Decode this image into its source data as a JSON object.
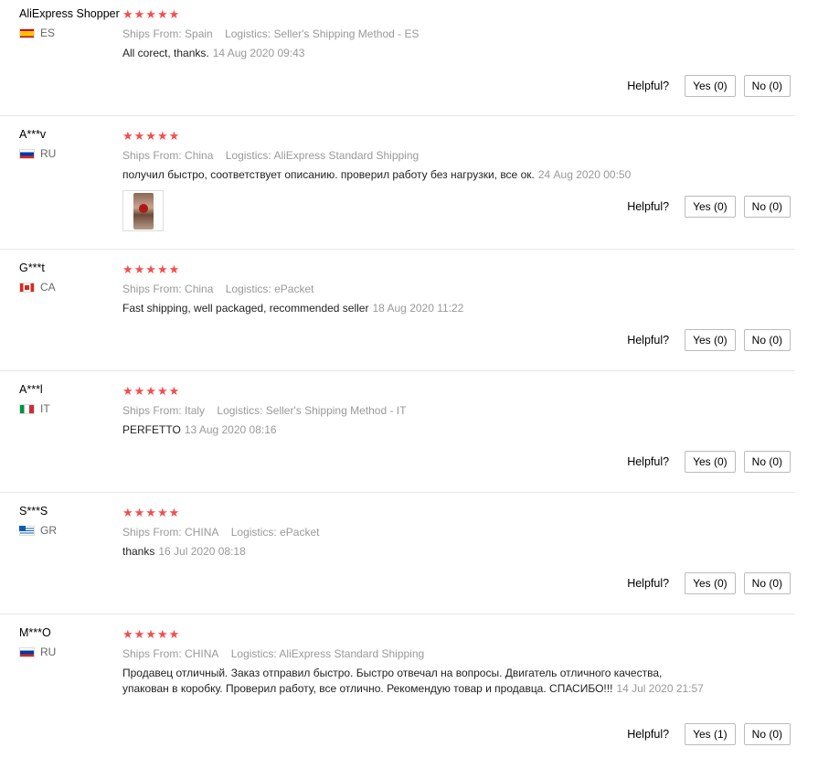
{
  "helpful_label": "Helpful?",
  "star_glyph": "★★★★★",
  "reviews": [
    {
      "user": "AliExpress Shopper",
      "country_code": "ES",
      "flag": "es",
      "ships_from_label": "Ships From:",
      "ships_from": "Spain",
      "logistics_label": "Logistics:",
      "logistics": "Seller's Shipping Method - ES",
      "text": "All corect, thanks.",
      "date": "14 Aug 2020 09:43",
      "yes": "Yes (0)",
      "no": "No (0)"
    },
    {
      "user": "A***v",
      "country_code": "RU",
      "flag": "ru",
      "ships_from_label": "Ships From:",
      "ships_from": "China",
      "logistics_label": "Logistics:",
      "logistics": "AliExpress Standard Shipping",
      "text": "получил быстро, соответствует описанию. проверил работу без нагрузки, все ок.",
      "date": "24 Aug 2020 00:50",
      "yes": "Yes (0)",
      "no": "No (0)"
    },
    {
      "user": "G***t",
      "country_code": "CA",
      "flag": "ca",
      "ships_from_label": "Ships From:",
      "ships_from": "China",
      "logistics_label": "Logistics:",
      "logistics": "ePacket",
      "text": "Fast shipping, well packaged, recommended seller",
      "date": "18 Aug 2020 11:22",
      "yes": "Yes (0)",
      "no": "No (0)"
    },
    {
      "user": "A***l",
      "country_code": "IT",
      "flag": "it",
      "ships_from_label": "Ships From:",
      "ships_from": "Italy",
      "logistics_label": "Logistics:",
      "logistics": "Seller's Shipping Method - IT",
      "text": "PERFETTO",
      "date": "13 Aug 2020 08:16",
      "yes": "Yes (0)",
      "no": "No (0)"
    },
    {
      "user": "S***S",
      "country_code": "GR",
      "flag": "gr",
      "ships_from_label": "Ships From:",
      "ships_from": "CHINA",
      "logistics_label": "Logistics:",
      "logistics": "ePacket",
      "text": "thanks",
      "date": "16 Jul 2020 08:18",
      "yes": "Yes (0)",
      "no": "No (0)"
    },
    {
      "user": "M***O",
      "country_code": "RU",
      "flag": "ru",
      "ships_from_label": "Ships From:",
      "ships_from": "CHINA",
      "logistics_label": "Logistics:",
      "logistics": "AliExpress Standard Shipping",
      "text": "Продавец отличный. Заказ отправил быстро. Быстро отвечал на вопросы. Двигатель отличного качества, упакован в коробку. Проверил работу, все отлично. Рекомендую товар и продавца. СПАСИБО!!!",
      "date": "14 Jul 2020 21:57",
      "yes": "Yes (1)",
      "no": "No (0)"
    }
  ]
}
